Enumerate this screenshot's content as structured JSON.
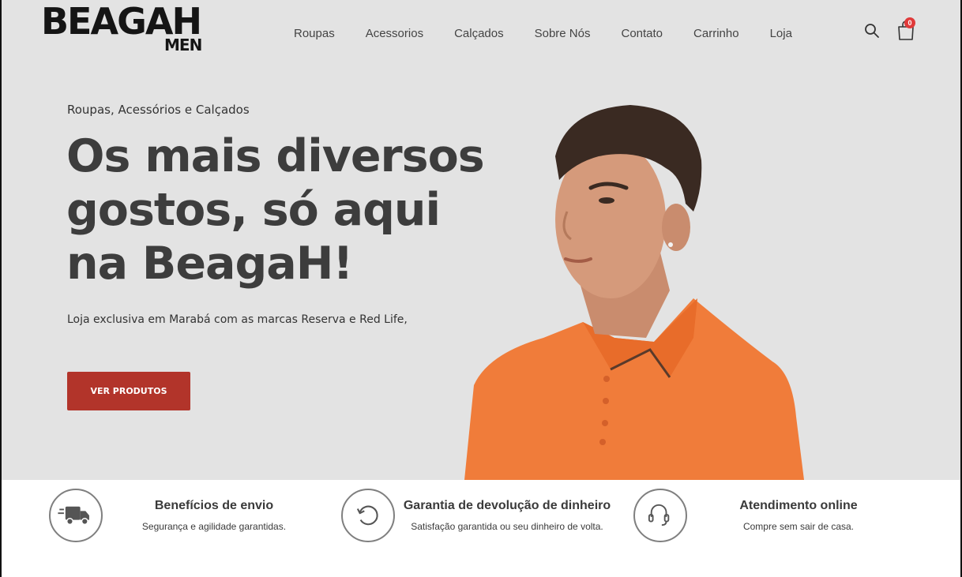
{
  "brand": {
    "logo_main": "BEAGAH",
    "logo_sub": "MEN"
  },
  "nav": {
    "items": [
      "Roupas",
      "Acessorios",
      "Calçados",
      "Sobre Nós",
      "Contato",
      "Carrinho",
      "Loja"
    ]
  },
  "header_icons": {
    "search": "search-icon",
    "cart": "shopping-bag-icon",
    "cart_count": "0"
  },
  "hero": {
    "eyebrow": "Roupas, Acessórios e Calçados",
    "headline": "Os mais diversos gostos, só aqui na BeagaH!",
    "subline": "Loja exclusiva em Marabá com as marcas Reserva e Red Life,",
    "cta_label": "VER PRODUTOS",
    "background_color": "#e3e3e3",
    "cta_color": "#b2342a",
    "shirt_color": "#f07c3a"
  },
  "features": [
    {
      "icon": "delivery-truck-icon",
      "title": "Benefícios de envio",
      "desc": "Segurança e agilidade garantidas."
    },
    {
      "icon": "refresh-icon",
      "title": "Garantia de devolução de dinheiro",
      "desc": "Satisfação garantida ou seu dinheiro de volta."
    },
    {
      "icon": "headset-icon",
      "title": "Atendimento online",
      "desc": "Compre sem sair de casa."
    }
  ]
}
